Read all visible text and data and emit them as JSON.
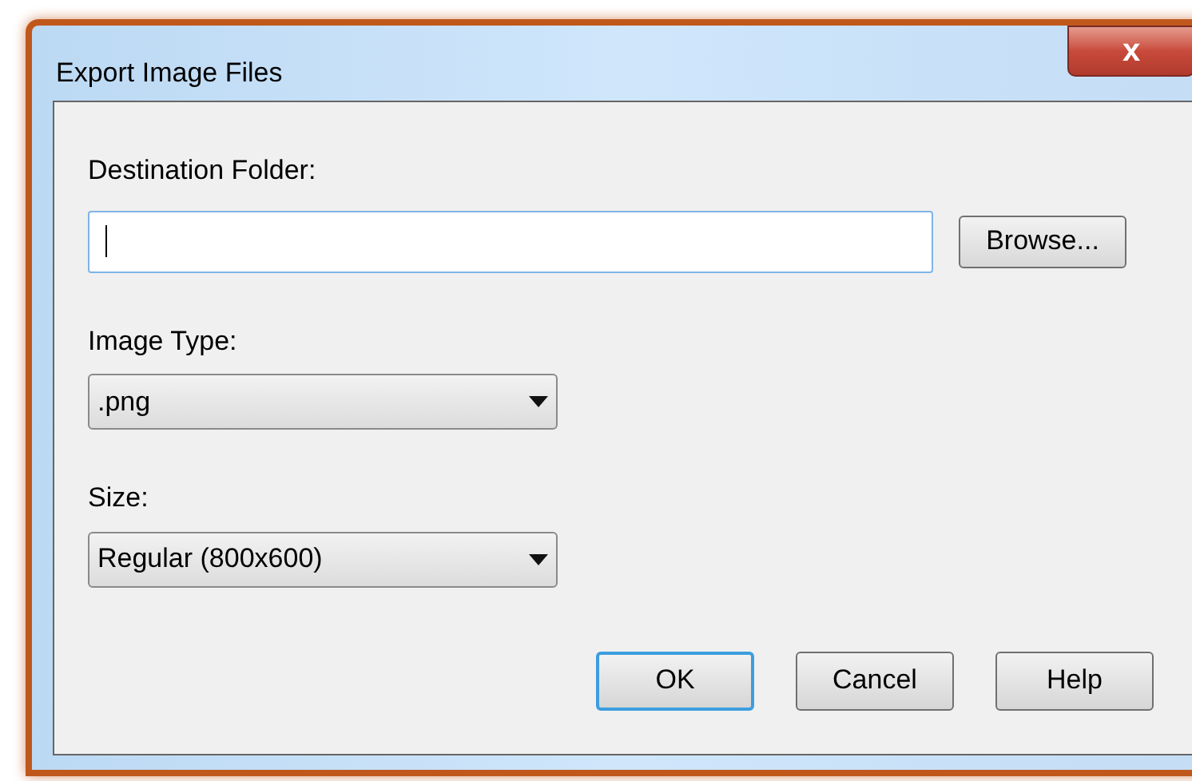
{
  "window": {
    "title": "Export Image Files",
    "close_icon": "x"
  },
  "destination": {
    "label": "Destination Folder:",
    "focused": true,
    "browse": "Browse..."
  },
  "image_type": {
    "label": "Image Type:",
    "value": ".png"
  },
  "size": {
    "label": "Size:",
    "value": "Regular (800x600)"
  },
  "buttons": [
    {
      "label": "OK",
      "default": true
    },
    {
      "label": "Cancel",
      "default": false
    },
    {
      "label": "Help",
      "default": false
    }
  ]
}
